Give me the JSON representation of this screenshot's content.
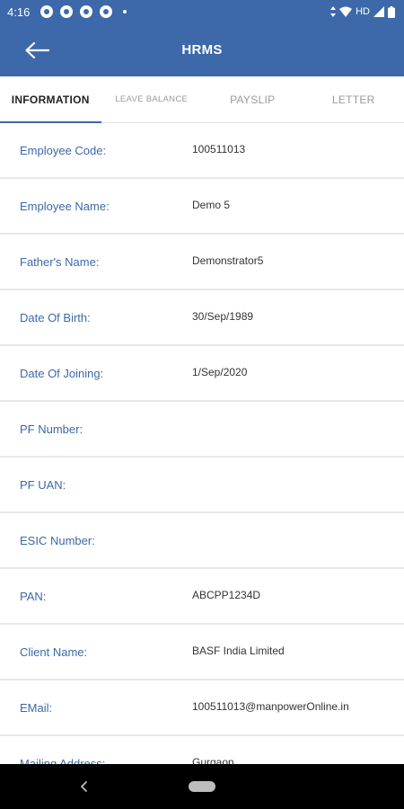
{
  "status_bar": {
    "time": "4:16",
    "network_label": "HD",
    "icons": [
      "notification-icon",
      "notification-icon",
      "notification-icon",
      "notification-icon",
      "wifi-icon",
      "signal-icon",
      "battery-icon"
    ]
  },
  "app_bar": {
    "title": "HRMS",
    "back_icon": "arrow-left-icon",
    "color": "#3d68aa"
  },
  "tabs": [
    {
      "label": "INFORMATION",
      "active": true
    },
    {
      "label": "LEAVE BALANCE",
      "active": false
    },
    {
      "label": "PAYSLIP",
      "active": false
    },
    {
      "label": "LETTER",
      "active": false
    }
  ],
  "info_rows": [
    {
      "label": "Employee Code:",
      "value": "100511013"
    },
    {
      "label": "Employee Name:",
      "value": "Demo 5"
    },
    {
      "label": "Father's Name:",
      "value": "Demonstrator5"
    },
    {
      "label": "Date Of Birth:",
      "value": "30/Sep/1989"
    },
    {
      "label": "Date Of Joining:",
      "value": "1/Sep/2020"
    },
    {
      "label": "PF Number:",
      "value": ""
    },
    {
      "label": "PF UAN:",
      "value": ""
    },
    {
      "label": "ESIC Number:",
      "value": ""
    },
    {
      "label": "PAN:",
      "value": "ABCPP1234D"
    },
    {
      "label": "Client Name:",
      "value": "BASF India Limited"
    },
    {
      "label": "EMail:",
      "value": "100511013@manpowerOnline.in"
    },
    {
      "label": "Mailing Address:",
      "value": "Gurgaon"
    }
  ],
  "nav_bar": {
    "back_icon": "nav-back-icon",
    "home_icon": "nav-home-pill-icon"
  }
}
